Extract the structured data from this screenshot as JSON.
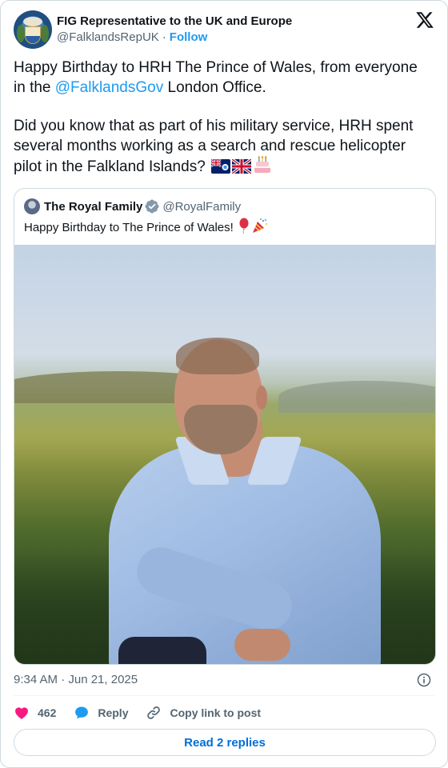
{
  "author": {
    "name": "FIG Representative to the UK and Europe",
    "handle": "@FalklandsRepUK",
    "separator": "·",
    "follow_label": "Follow"
  },
  "tweet": {
    "paragraph1_before": "Happy Birthday to HRH The Prince of Wales, from everyone in the ",
    "mention": "@FalklandsGov",
    "paragraph1_after": " London Office.",
    "paragraph2": "Did you know that as part of his military service, HRH spent several months working as a search and rescue helicopter pilot in the Falkland Islands?",
    "emojis": [
      "falkland-islands-flag",
      "union-jack-flag",
      "birthday-cake"
    ]
  },
  "quote": {
    "name": "The Royal Family",
    "handle": "@RoyalFamily",
    "text": "Happy Birthday to The Prince of Wales!",
    "emojis": [
      "balloon",
      "party-popper"
    ],
    "image": "photo-prince-of-wales"
  },
  "meta": {
    "timestamp": "9:34 AM · Jun 21, 2025"
  },
  "actions": {
    "like_count": "462",
    "reply_label": "Reply",
    "copy_label": "Copy link to post",
    "read_replies_label": "Read 2 replies"
  },
  "colors": {
    "accent": "#1d9bf0",
    "link": "#006fd6",
    "like": "#f91880",
    "secondary_text": "#536471",
    "border": "#cfd9de"
  }
}
